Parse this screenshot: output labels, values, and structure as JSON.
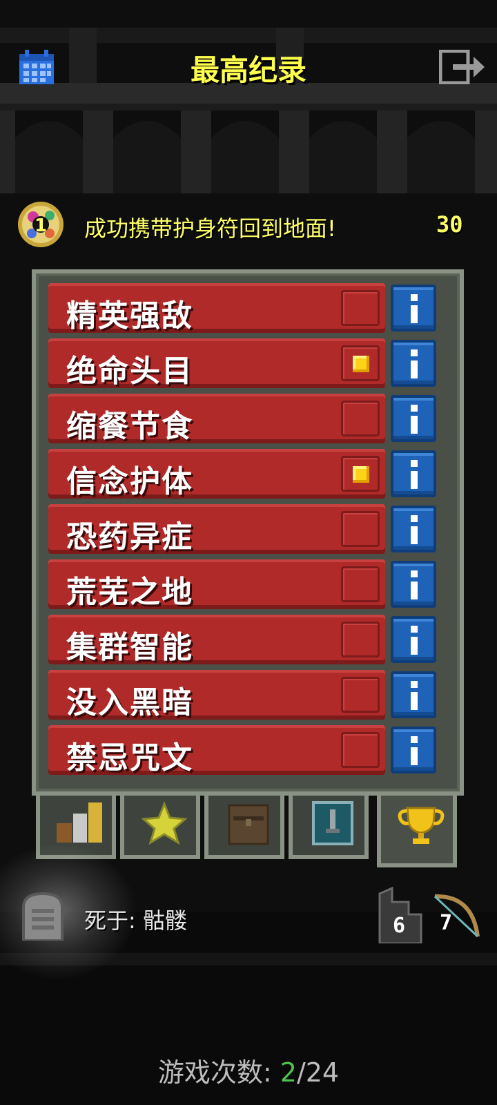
{
  "header": {
    "title": "最高纪录",
    "left_icon": "calendar-icon",
    "right_icon": "exit-icon"
  },
  "top_record": {
    "rank": "1",
    "text": "成功携带护身符回到地面!",
    "depth": "30"
  },
  "challenges": {
    "items": [
      {
        "label": "精英强敌",
        "checked": false
      },
      {
        "label": "绝命头目",
        "checked": true
      },
      {
        "label": "缩餐节食",
        "checked": false
      },
      {
        "label": "信念护体",
        "checked": true
      },
      {
        "label": "恐药异症",
        "checked": false
      },
      {
        "label": "荒芜之地",
        "checked": false
      },
      {
        "label": "集群智能",
        "checked": false
      },
      {
        "label": "没入黑暗",
        "checked": false
      },
      {
        "label": "禁忌咒文",
        "checked": false
      }
    ],
    "info_icon": "info-icon"
  },
  "tabs": [
    {
      "icon": "stats-icon"
    },
    {
      "icon": "badges-icon"
    },
    {
      "icon": "catalog-icon"
    },
    {
      "icon": "journal-icon"
    },
    {
      "icon": "trophy-icon",
      "active": true
    }
  ],
  "bottom_record": {
    "death_text": "死于: 骷髅",
    "depth": "6",
    "level": "7"
  },
  "footer": {
    "games_label": "游戏次数: ",
    "games_current": "2",
    "games_total": "/24"
  },
  "colors": {
    "title": "#ffff4d",
    "challenge_button": "#b12a2a",
    "info_button": "#1f63b8",
    "checkmark": "#ffd21a",
    "games_current": "#4fc24f"
  }
}
